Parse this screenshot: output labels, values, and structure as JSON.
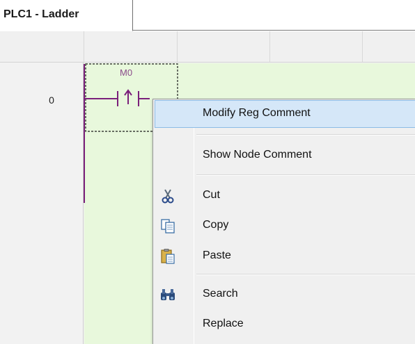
{
  "tab": {
    "label": "PLC1 - Ladder"
  },
  "ladder": {
    "rung_number": "0",
    "contact_label": "M0"
  },
  "context_menu": {
    "items": [
      {
        "label": "Modify Reg Comment",
        "highlighted": true,
        "icon": ""
      },
      {
        "label": "Show Node Comment",
        "highlighted": false,
        "icon": ""
      },
      {
        "label": "Cut",
        "highlighted": false,
        "icon": "scissors-icon"
      },
      {
        "label": "Copy",
        "highlighted": false,
        "icon": "copy-icon"
      },
      {
        "label": "Paste",
        "highlighted": false,
        "icon": "paste-icon"
      },
      {
        "label": "Search",
        "highlighted": false,
        "icon": "binoculars-icon"
      },
      {
        "label": "Replace",
        "highlighted": false,
        "icon": ""
      }
    ]
  },
  "colors": {
    "ladder_background": "#e8f8dc",
    "rail": "#7a1f7a",
    "highlight": "#d5e7f8",
    "highlight_border": "#8cbbe6"
  }
}
